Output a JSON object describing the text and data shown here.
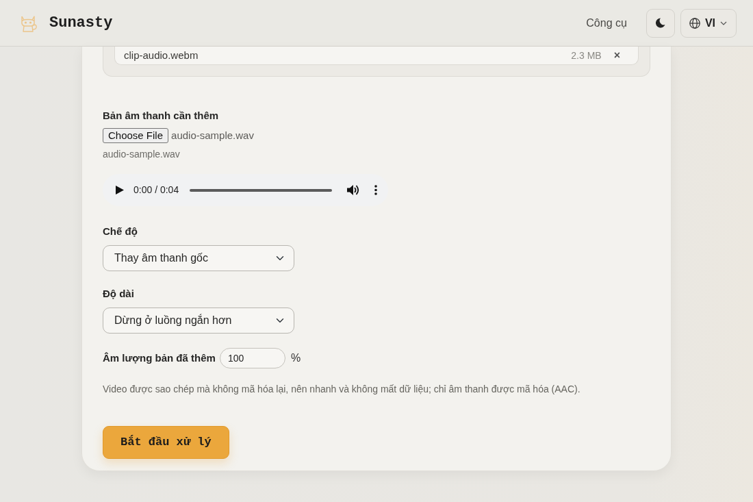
{
  "header": {
    "brand": "Sunasty",
    "nav_link": "Công cụ",
    "language": "VI"
  },
  "file_list": [
    {
      "name": "clip-audio.webm",
      "size": "2.3 MB",
      "remove": "×"
    }
  ],
  "audio_field": {
    "label": "Bản âm thanh cần thêm",
    "button": "Choose File",
    "chosen_file": "audio-sample.wav",
    "file_name": "audio-sample.wav"
  },
  "player": {
    "time": "0:00 / 0:04"
  },
  "mode": {
    "label": "Chế độ",
    "value": "Thay âm thanh gốc"
  },
  "duration": {
    "label": "Độ dài",
    "value": "Dừng ở luồng ngắn hơn"
  },
  "volume": {
    "label": "Âm lượng bản đã thêm",
    "value": "100",
    "unit": "%"
  },
  "note": "Video được sao chép mà không mã hóa lại, nên nhanh và không mất dữ liệu; chỉ âm thanh được mã hóa (AAC).",
  "submit": "Bắt đầu xử lý"
}
